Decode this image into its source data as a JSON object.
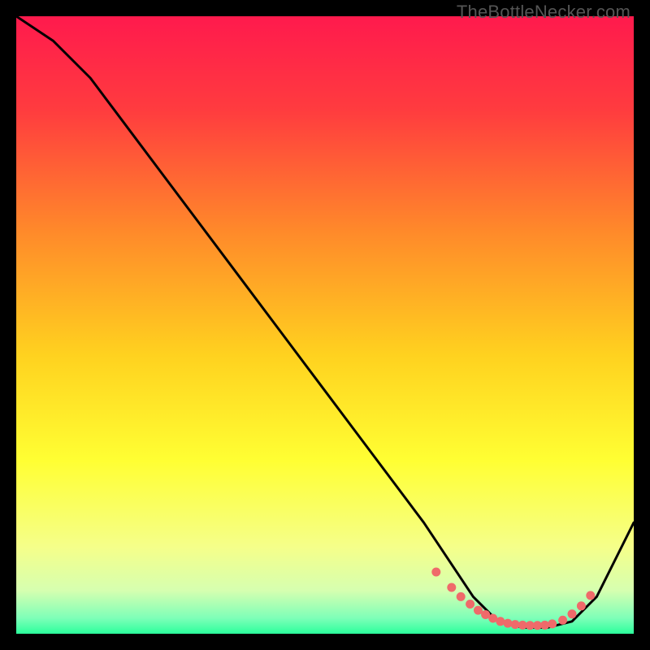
{
  "watermark": "TheBottleNecker.com",
  "gradient": {
    "stops": [
      {
        "offset": 0.0,
        "color": "#ff1a4d"
      },
      {
        "offset": 0.15,
        "color": "#ff3b3f"
      },
      {
        "offset": 0.35,
        "color": "#ff8a2a"
      },
      {
        "offset": 0.55,
        "color": "#ffd21f"
      },
      {
        "offset": 0.72,
        "color": "#ffff33"
      },
      {
        "offset": 0.86,
        "color": "#f5ff8a"
      },
      {
        "offset": 0.93,
        "color": "#d6ffb0"
      },
      {
        "offset": 0.975,
        "color": "#7dffb8"
      },
      {
        "offset": 1.0,
        "color": "#2bff9c"
      }
    ]
  },
  "chart_data": {
    "type": "line",
    "title": "",
    "xlabel": "",
    "ylabel": "",
    "xlim": [
      0,
      100
    ],
    "ylim": [
      0,
      100
    ],
    "series": [
      {
        "name": "curve",
        "x": [
          0,
          6,
          12,
          18,
          24,
          30,
          36,
          42,
          48,
          54,
          60,
          66,
          70,
          74,
          78,
          82,
          86,
          90,
          94,
          100
        ],
        "y": [
          100,
          96,
          90,
          82,
          74,
          66,
          58,
          50,
          42,
          34,
          26,
          18,
          12,
          6,
          2,
          1,
          1,
          2,
          6,
          18
        ]
      }
    ],
    "markers": {
      "name": "dots",
      "color": "#ef6a6a",
      "x": [
        68,
        70.5,
        72,
        73.5,
        74.8,
        76,
        77.2,
        78.4,
        79.6,
        80.8,
        82,
        83.2,
        84.4,
        85.6,
        86.8,
        88.5,
        90,
        91.5,
        93
      ],
      "y": [
        10,
        7.5,
        6,
        4.8,
        3.8,
        3.1,
        2.5,
        2.0,
        1.7,
        1.5,
        1.4,
        1.35,
        1.35,
        1.4,
        1.6,
        2.2,
        3.2,
        4.5,
        6.2
      ]
    }
  }
}
